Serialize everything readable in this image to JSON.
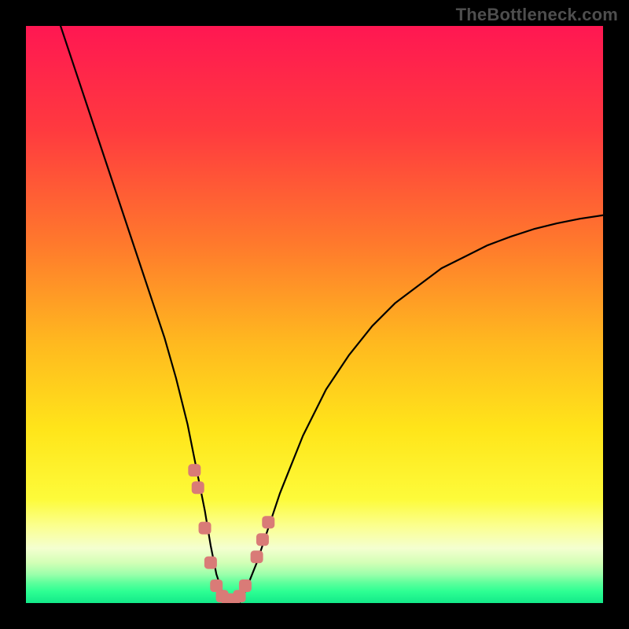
{
  "watermark": "TheBottleneck.com",
  "chart_data": {
    "type": "line",
    "title": "",
    "xlabel": "",
    "ylabel": "",
    "xlim": [
      0,
      100
    ],
    "ylim": [
      0,
      100
    ],
    "grid": false,
    "series": [
      {
        "name": "bottleneck-curve",
        "x": [
          6,
          8,
          10,
          12,
          14,
          16,
          18,
          20,
          22,
          24,
          26,
          28,
          29,
          30,
          31,
          32,
          33,
          34,
          35,
          36,
          37,
          38,
          40,
          42,
          44,
          46,
          48,
          52,
          56,
          60,
          64,
          68,
          72,
          76,
          80,
          84,
          88,
          92,
          96,
          100
        ],
        "y": [
          100,
          94,
          88,
          82,
          76,
          70,
          64,
          58,
          52,
          46,
          39,
          31,
          26,
          21,
          16,
          10,
          5,
          2,
          0,
          0,
          0,
          2,
          7,
          13,
          19,
          24,
          29,
          37,
          43,
          48,
          52,
          55,
          58,
          60,
          62,
          63.5,
          64.8,
          65.8,
          66.6,
          67.2
        ]
      }
    ],
    "markers": {
      "name": "highlight-points",
      "color": "#d97b77",
      "points": [
        {
          "x": 29.2,
          "y": 23
        },
        {
          "x": 29.8,
          "y": 20
        },
        {
          "x": 31.0,
          "y": 13
        },
        {
          "x": 32.0,
          "y": 7
        },
        {
          "x": 33.0,
          "y": 3
        },
        {
          "x": 34.0,
          "y": 1.2
        },
        {
          "x": 35.0,
          "y": 0.6
        },
        {
          "x": 36.0,
          "y": 0.6
        },
        {
          "x": 37.0,
          "y": 1.2
        },
        {
          "x": 38.0,
          "y": 3
        },
        {
          "x": 40.0,
          "y": 8
        },
        {
          "x": 41.0,
          "y": 11
        },
        {
          "x": 42.0,
          "y": 14
        }
      ]
    },
    "background_bands": [
      {
        "stop": 0.0,
        "color": "#ff1752"
      },
      {
        "stop": 0.18,
        "color": "#ff3a3f"
      },
      {
        "stop": 0.38,
        "color": "#ff7a2c"
      },
      {
        "stop": 0.55,
        "color": "#ffb91f"
      },
      {
        "stop": 0.7,
        "color": "#ffe51a"
      },
      {
        "stop": 0.82,
        "color": "#fdfb3a"
      },
      {
        "stop": 0.865,
        "color": "#fbff8d"
      },
      {
        "stop": 0.905,
        "color": "#f4ffd0"
      },
      {
        "stop": 0.93,
        "color": "#d3ffb6"
      },
      {
        "stop": 0.95,
        "color": "#9cffab"
      },
      {
        "stop": 0.965,
        "color": "#5eff9c"
      },
      {
        "stop": 0.98,
        "color": "#2dff93"
      },
      {
        "stop": 1.0,
        "color": "#13e989"
      }
    ]
  }
}
